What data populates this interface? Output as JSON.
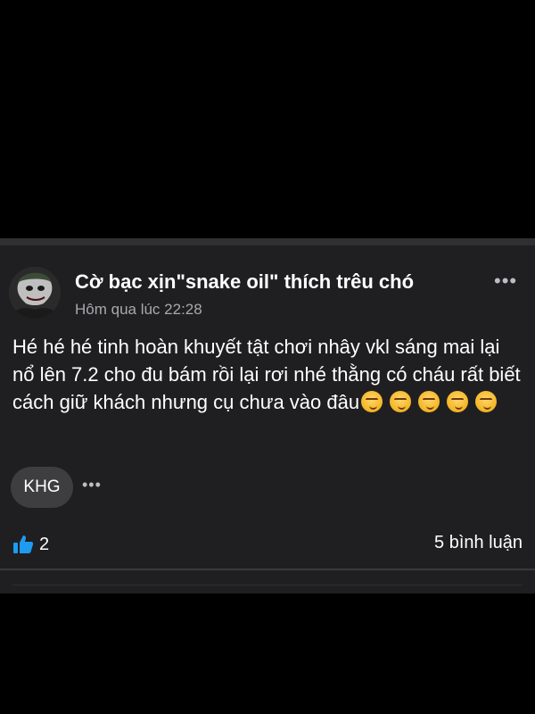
{
  "post": {
    "author": "Cờ bạc xịn\"snake oil\" thích trêu chó",
    "time": "Hôm qua lúc 22:28",
    "more_label": "•••",
    "text": "Hé hé hé tinh hoàn khuyết tật chơi nhây vkl sáng mai lại nổ lên 7.2 cho đu bám rồi lại rơi nhé thằng có cháu rất biết cách giữ khách nhưng cụ chưa vào đâu",
    "emojis": [
      "smirking-face",
      "smirking-face",
      "smirking-face",
      "smirking-face",
      "smirking-face"
    ],
    "tag": "KHG",
    "tags_more_label": "•••",
    "like_count": "2",
    "comments": "5 bình luận"
  },
  "colors": {
    "background": "#000000",
    "card": "#1f1f21",
    "text": "#ffffff",
    "muted": "#a9a9ad",
    "pill": "#3e3e41",
    "like_blue": "#1e9bf0"
  }
}
